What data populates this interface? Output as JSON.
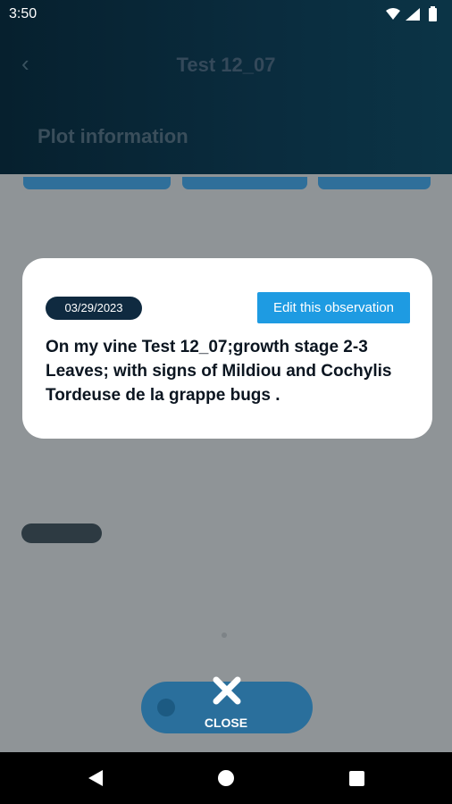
{
  "status_bar": {
    "time": "3:50"
  },
  "toolbar": {
    "title": "Test 12_07"
  },
  "tabs": {
    "plot_information": "Plot information"
  },
  "dialog": {
    "date": "03/29/2023",
    "edit_button": "Edit this observation",
    "observation_text": "On my vine Test 12_07;growth stage 2-3 Leaves; with signs of Mildiou and Cochylis Tordeuse de la grappe bugs ."
  },
  "close": {
    "label": "CLOSE"
  },
  "icons": {
    "back": "chevron-left-icon",
    "close": "close-icon",
    "wifi": "wifi-icon",
    "signal": "signal-icon",
    "battery": "battery-icon"
  },
  "colors": {
    "header_dark": "#06202e",
    "accent_blue": "#1e9be2",
    "date_badge": "#0f2a40"
  }
}
